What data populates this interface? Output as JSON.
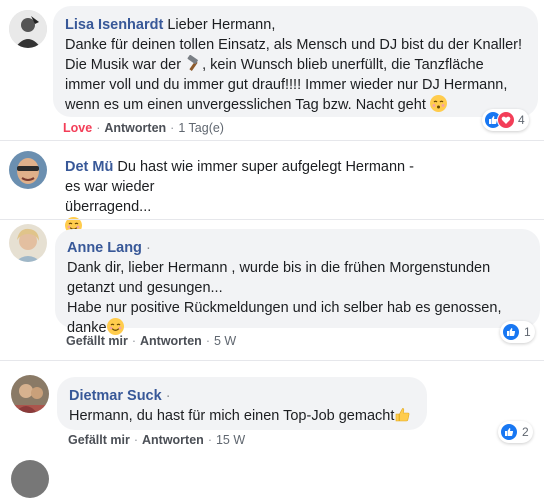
{
  "comments": [
    {
      "author": "Lisa Isenhardt",
      "text_1": "Lieber Hermann,",
      "text_2": "Danke für deinen tollen Einsatz, als Mensch und DJ bist du der Knaller!",
      "text_3a": "Die Musik war der",
      "text_3b": ", kein Wunsch blieb unerfüllt, die Tanzfläche",
      "text_4": "immer voll und du immer gut drauf!!!! Immer wieder nur DJ Hermann,",
      "text_5": "wenn es um einen unvergesslichen Tag bzw. Nacht geht",
      "action_love": "Love",
      "action_reply": "Antworten",
      "time": "1 Tag(e)",
      "reaction_count": "4"
    },
    {
      "author": "Det Mü",
      "text_1": "Du hast wie immer super aufgelegt Hermann - es war wieder",
      "text_2": "überragend..."
    },
    {
      "author": "Anne Lang",
      "text_1": "Dank dir, lieber Hermann , wurde bis in die frühen Morgenstunden",
      "text_2": "getanzt und gesungen...",
      "text_3": "Habe nur positive Rückmeldungen und ich selber hab es genossen,",
      "text_4": "danke",
      "action_like": "Gefällt mir",
      "action_reply": "Antworten",
      "time": "5 W",
      "reaction_count": "1"
    },
    {
      "author": "Dietmar Suck",
      "text_1": "Hermann, du hast für mich einen Top-Job gemacht",
      "action_like": "Gefällt mir",
      "action_reply": "Antworten",
      "time": "15 W",
      "reaction_count": "2"
    }
  ],
  "separator": "·",
  "colors": {
    "author": "#385898",
    "bubble": "#f2f3f5",
    "like": "#1877f2",
    "love": "#f33e58"
  },
  "icons": [
    "like-icon",
    "love-icon",
    "hammer-emoji",
    "kissing-emoji",
    "smile-emoji",
    "thumbs-up-emoji"
  ]
}
